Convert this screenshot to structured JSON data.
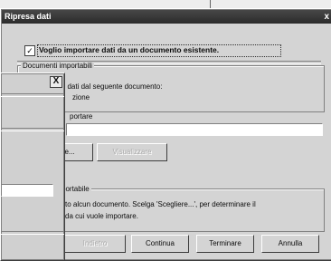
{
  "window": {
    "title": "Ripresa dati",
    "close_glyph": "x"
  },
  "import_checkbox": {
    "checked_glyph": "✓",
    "label": "Voglio importare dati da un documento esistente."
  },
  "documents_group": {
    "title": "Documenti importabili",
    "line1": "Può importare dati dal seguente documento:",
    "line2_partial": "zione"
  },
  "file_section": {
    "label_partial": "portare"
  },
  "buttons_row1": {
    "choose_partial": "e...",
    "view": "Visualizzare"
  },
  "info_group": {
    "title_partial": "portabile",
    "line1": "to alcun documento. Scelga 'Scegliere...', per determinare il",
    "line2": "da cui vuole importare."
  },
  "footer": {
    "back_partial": "Indietro",
    "continue": "Continua",
    "finish": "Terminare",
    "cancel": "Annulla"
  },
  "front_dialog": {
    "close_glyph": "X"
  }
}
